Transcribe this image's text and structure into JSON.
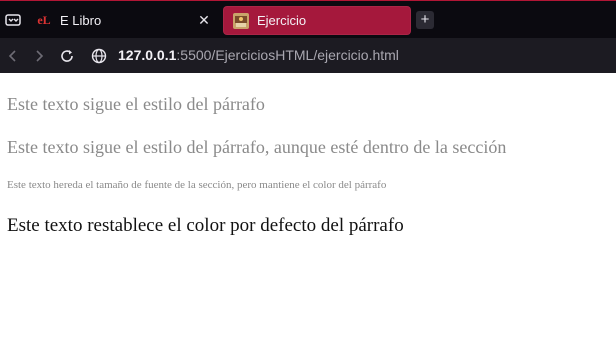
{
  "browser": {
    "tabs": [
      {
        "label": "E Libro",
        "icon": "elibro-favicon",
        "active": false
      },
      {
        "label": "Ejercicio",
        "icon": "page-favicon",
        "active": true
      }
    ],
    "new_tab_label": "+",
    "close_glyph": "✕",
    "favicon_text": "eL",
    "url": {
      "host": "127.0.0.1",
      "rest": ":5500/EjerciciosHTML/ejercicio.html"
    },
    "accent_color": "#a5183c"
  },
  "page": {
    "lines": [
      "Este texto sigue el estilo del párrafo",
      "Este texto sigue el estilo del párrafo, aunque esté dentro de la sección",
      "Este texto hereda el tamaño de fuente de la sección, pero mantiene el color del párrafo",
      "Este texto restablece el color por defecto del párrafo"
    ]
  }
}
